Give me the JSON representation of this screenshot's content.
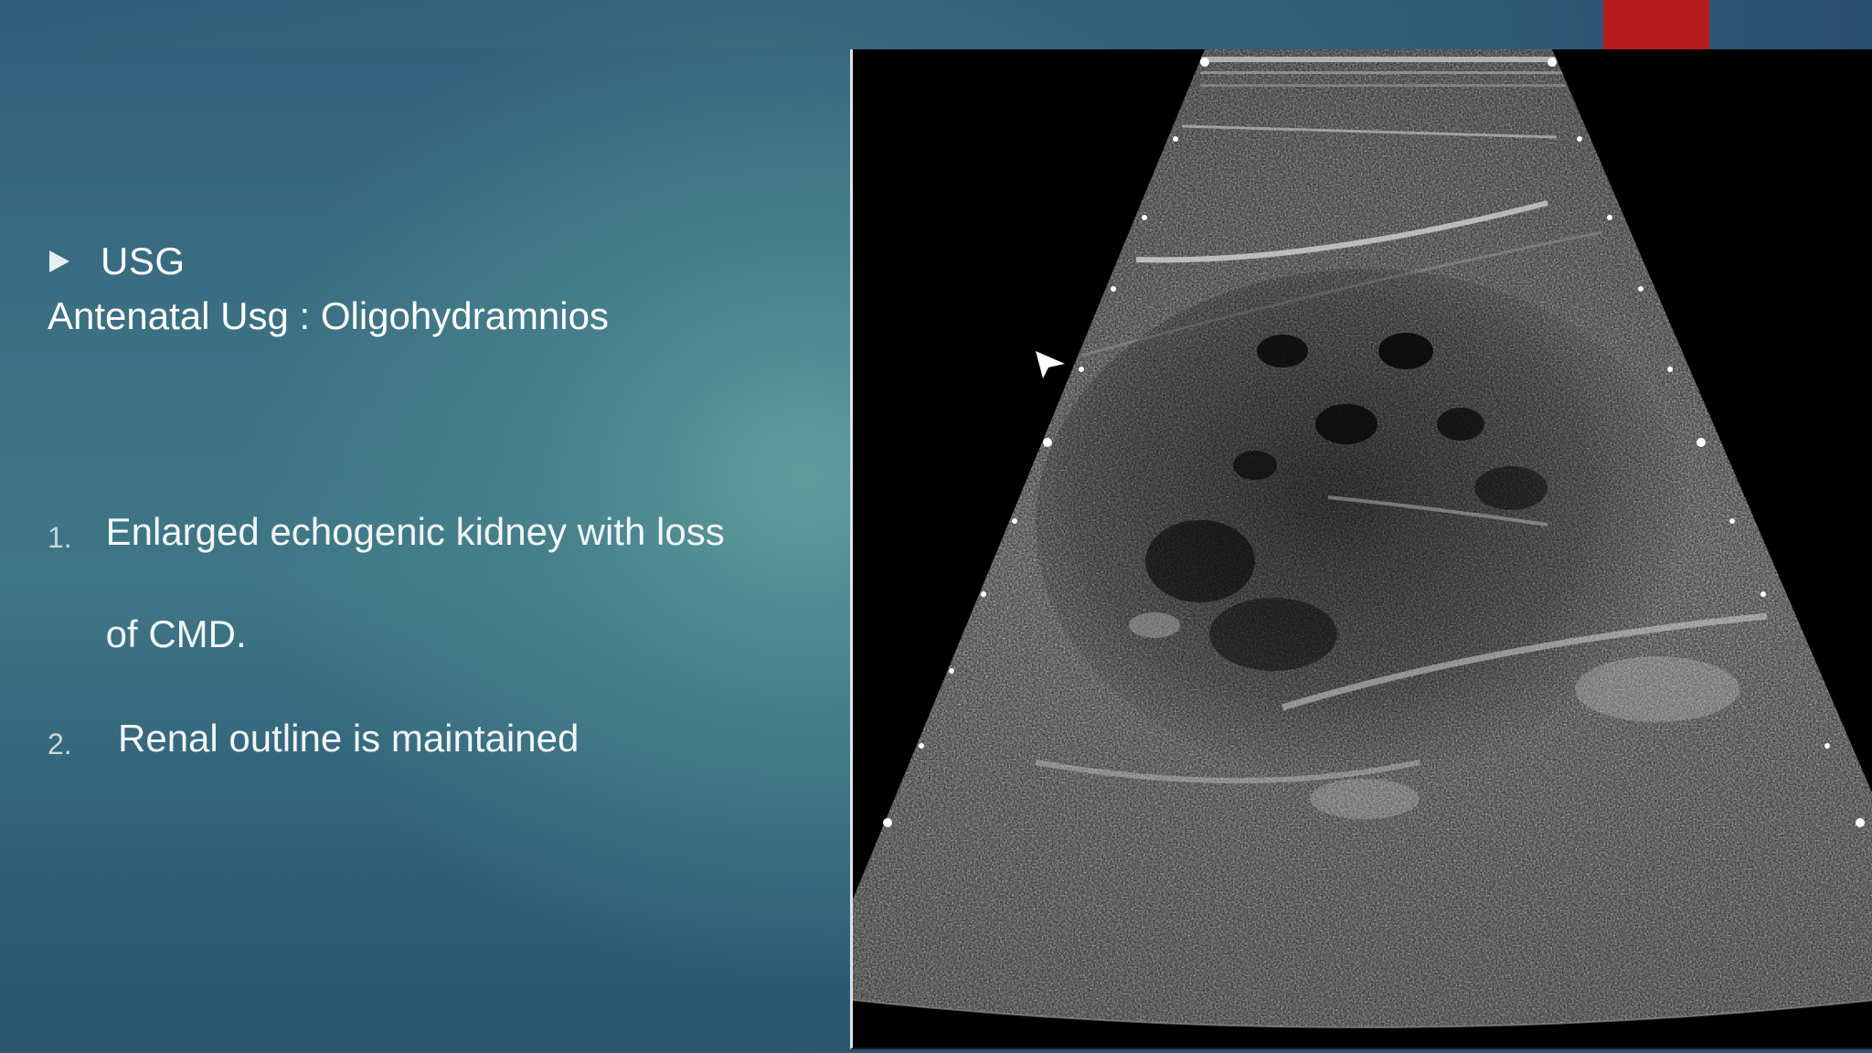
{
  "slide": {
    "heading": "USG",
    "subheading": "Antenatal Usg : Oligohydramnios",
    "points": [
      {
        "number": "1.",
        "text": "Enlarged echogenic kidney with loss of CMD."
      },
      {
        "number": "2.",
        "text": "Renal outline is maintained"
      }
    ]
  },
  "image": {
    "subject": "ultrasound-kidney-scan"
  },
  "colors": {
    "accent": "#b71c1c",
    "background_deep": "#2f5d79",
    "background_glow": "#629e9e"
  }
}
